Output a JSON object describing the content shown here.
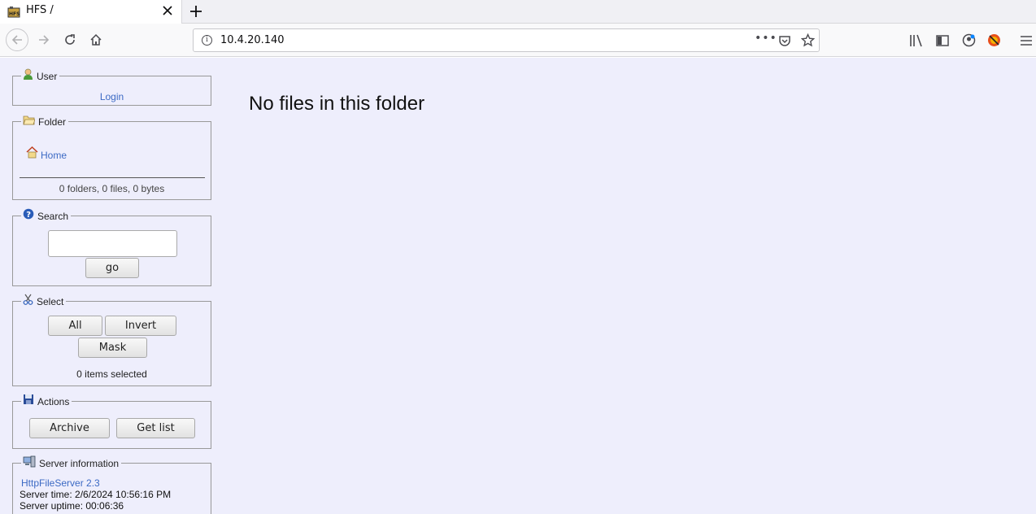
{
  "browser": {
    "tab_title": "HFS /",
    "url": "10.4.20.140",
    "more_label": "•••"
  },
  "sidebar": {
    "user": {
      "legend": "User",
      "login_label": "Login"
    },
    "folder": {
      "legend": "Folder",
      "home_label": "Home",
      "summary": "0 folders, 0 files, 0 bytes"
    },
    "search": {
      "legend": "Search",
      "input_value": "",
      "go_label": "go"
    },
    "select": {
      "legend": "Select",
      "all_label": "All",
      "invert_label": "Invert",
      "mask_label": "Mask",
      "status": "0 items selected"
    },
    "actions": {
      "legend": "Actions",
      "archive_label": "Archive",
      "getlist_label": "Get list"
    },
    "server": {
      "legend": "Server information",
      "software_link": "HttpFileServer 2.3",
      "time": "Server time: 2/6/2024 10:56:16 PM",
      "uptime": "Server uptime: 00:06:36"
    }
  },
  "main": {
    "message": "No files in this folder"
  }
}
